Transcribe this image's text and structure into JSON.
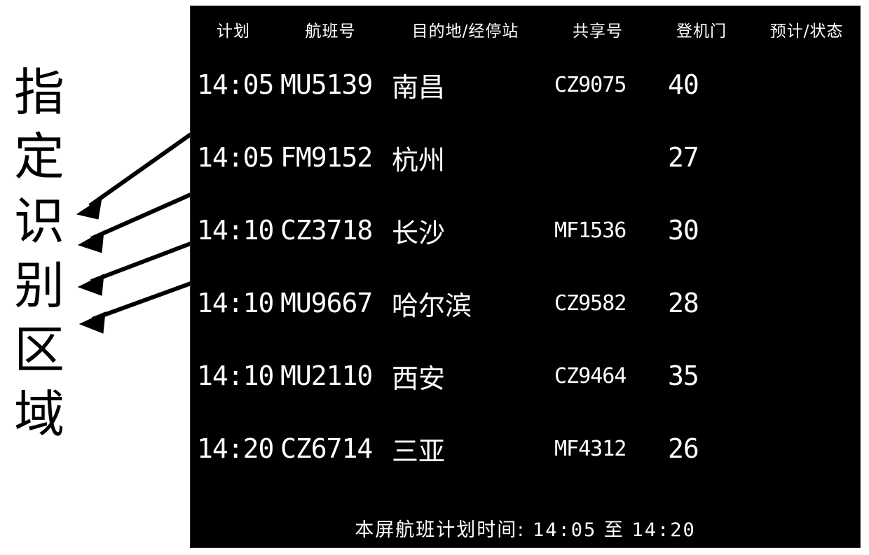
{
  "annotation": {
    "label_text": "指定识别区域",
    "chars": [
      "指",
      "定",
      "识",
      "别",
      "区",
      "域"
    ],
    "arrow_count": 4,
    "arrow_color": "#000000"
  },
  "panel": {
    "background_color": "#000000",
    "text_color": "#ffffff"
  },
  "board": {
    "columns": [
      {
        "key": "time",
        "label": "计划"
      },
      {
        "key": "flight",
        "label": "航班号"
      },
      {
        "key": "dest",
        "label": "目的地/经停站"
      },
      {
        "key": "share",
        "label": "共享号"
      },
      {
        "key": "gate",
        "label": "登机门"
      },
      {
        "key": "status",
        "label": "预计/状态"
      }
    ],
    "rows": [
      {
        "time": "14:05",
        "flight": "MU5139",
        "dest": "南昌",
        "share": "CZ9075",
        "gate": "40",
        "status": ""
      },
      {
        "time": "14:05",
        "flight": "FM9152",
        "dest": "杭州",
        "share": "",
        "gate": "27",
        "status": ""
      },
      {
        "time": "14:10",
        "flight": "CZ3718",
        "dest": "长沙",
        "share": "MF1536",
        "gate": "30",
        "status": ""
      },
      {
        "time": "14:10",
        "flight": "MU9667",
        "dest": "哈尔滨",
        "share": "CZ9582",
        "gate": "28",
        "status": ""
      },
      {
        "time": "14:10",
        "flight": "MU2110",
        "dest": "西安",
        "share": "CZ9464",
        "gate": "35",
        "status": ""
      },
      {
        "time": "14:20",
        "flight": "CZ6714",
        "dest": "三亚",
        "share": "MF4312",
        "gate": "26",
        "status": ""
      }
    ],
    "footer": {
      "prefix": "本屏航班计划时间:",
      "start_time": "14:05",
      "separator": "至",
      "end_time": "14:20",
      "full_text": "本屏航班计划时间: 14:05 至 14:20"
    }
  }
}
